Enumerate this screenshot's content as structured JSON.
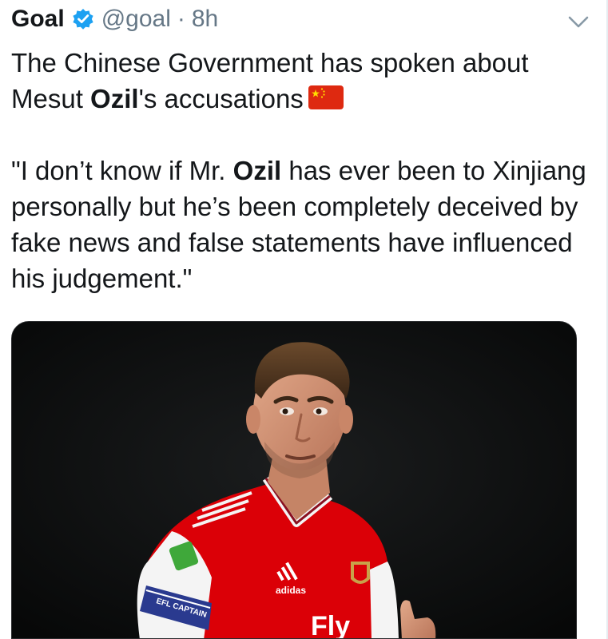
{
  "author": {
    "name": "Goal",
    "handle": "@goal",
    "separator": "·",
    "time": "8h",
    "verified_icon": "verified-badge-icon"
  },
  "menu_icon": "chevron-down-icon",
  "tweet": {
    "line1_a": "The Chinese Government has spoken about",
    "line2_a": "Mesut ",
    "line2_bold": "Ozil",
    "line2_b": "'s accusations",
    "flag_icon": "china-flag-icon",
    "quote_a": "\"I don’t know if Mr. ",
    "quote_bold": "Ozil",
    "quote_b": " has ever been to Xinjiang personally but he’s been completely deceived by fake news and false statements have influenced his judgement.\""
  },
  "media": {
    "kit_brand": "adidas",
    "kit_sponsor": "Fly",
    "armband_text": "EFL CAPTAIN"
  },
  "colors": {
    "text": "#14171a",
    "secondary": "#657786",
    "verified": "#1da1f2",
    "flag_red": "#de2910",
    "flag_yellow": "#ffde00",
    "kit_red": "#db0007"
  }
}
